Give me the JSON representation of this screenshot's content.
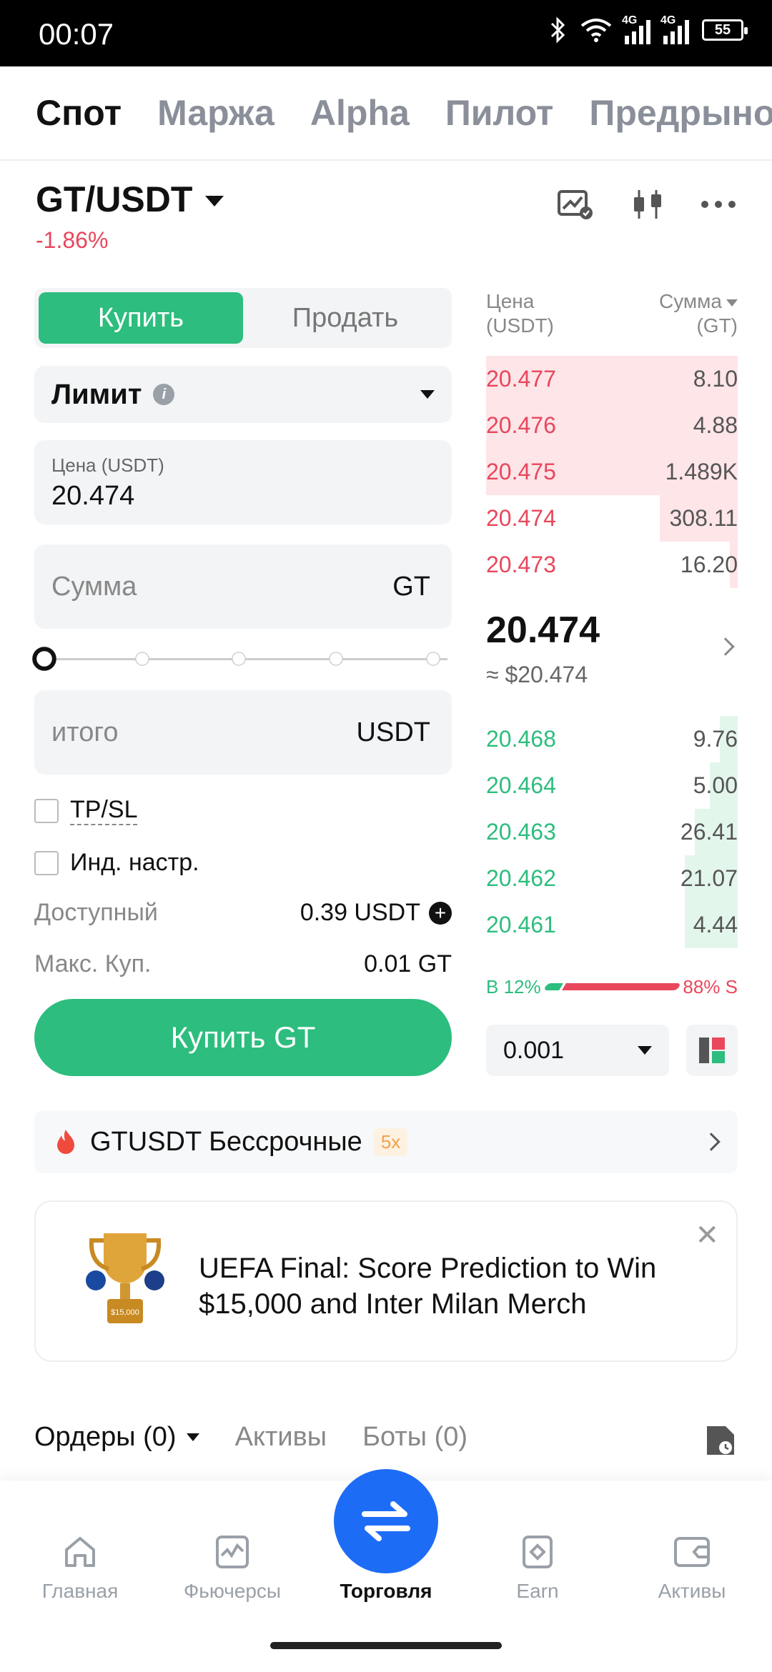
{
  "status_bar": {
    "time": "00:07",
    "net1": "4G",
    "net2": "4G",
    "battery": "55"
  },
  "top_tabs": [
    "Спот",
    "Маржа",
    "Alpha",
    "Пилот",
    "Предрынок"
  ],
  "pair": {
    "name": "GT/USDT",
    "change": "-1.86%"
  },
  "form": {
    "buy_label": "Купить",
    "sell_label": "Продать",
    "order_type": "Лимит",
    "price_label": "Цена (USDT)",
    "price_value": "20.474",
    "amount_placeholder": "Сумма",
    "amount_unit": "GT",
    "total_placeholder": "итого",
    "total_unit": "USDT",
    "slider_percent": 0,
    "tpsl_label": "TP/SL",
    "ind_label": "Инд. настр.",
    "available_label": "Доступный",
    "available_value": "0.39 USDT",
    "max_label": "Макс. Куп.",
    "max_value": "0.01 GT",
    "buy_button": "Купить GT"
  },
  "orderbook": {
    "col_price_1": "Цена",
    "col_price_2": "(USDT)",
    "col_amount_1": "Сумма",
    "col_amount_2": "(GT)",
    "asks": [
      {
        "price": "20.477",
        "amount": "8.10",
        "depth": 1.0
      },
      {
        "price": "20.476",
        "amount": "4.88",
        "depth": 1.0
      },
      {
        "price": "20.475",
        "amount": "1.489K",
        "depth": 1.0
      },
      {
        "price": "20.474",
        "amount": "308.11",
        "depth": 0.31
      },
      {
        "price": "20.473",
        "amount": "16.20",
        "depth": 0.03
      }
    ],
    "last_price": "20.474",
    "last_price_usd": "≈ $20.474",
    "bids": [
      {
        "price": "20.468",
        "amount": "9.76",
        "depth": 0.07
      },
      {
        "price": "20.464",
        "amount": "5.00",
        "depth": 0.11
      },
      {
        "price": "20.463",
        "amount": "26.41",
        "depth": 0.17
      },
      {
        "price": "20.462",
        "amount": "21.07",
        "depth": 0.21
      },
      {
        "price": "20.461",
        "amount": "4.44",
        "depth": 0.21
      }
    ],
    "buy_ratio": "B 12%",
    "sell_ratio": "88% S",
    "buy_ratio_value": 12,
    "precision": "0.001"
  },
  "perpetual": {
    "label": "GTUSDT Бессрочные",
    "leverage": "5x"
  },
  "promo": {
    "line1": "UEFA Final: Score Prediction to Win",
    "line2": "$15,000 and Inter Milan Merch",
    "prize_label": "$15,000"
  },
  "orders_tabs": {
    "orders": "Ордеры (0)",
    "assets": "Активы",
    "bots": "Боты (0)"
  },
  "bottom_nav": [
    {
      "label": "Главная",
      "icon": "home-icon"
    },
    {
      "label": "Фьючерсы",
      "icon": "futures-icon"
    },
    {
      "label": "Торговля",
      "icon": "trade-swap-icon"
    },
    {
      "label": "Earn",
      "icon": "earn-icon"
    },
    {
      "label": "Активы",
      "icon": "wallet-icon"
    }
  ],
  "colors": {
    "buy_green": "#2dbd7e",
    "sell_red": "#e8475c",
    "trade_blue": "#1d6cf6"
  }
}
